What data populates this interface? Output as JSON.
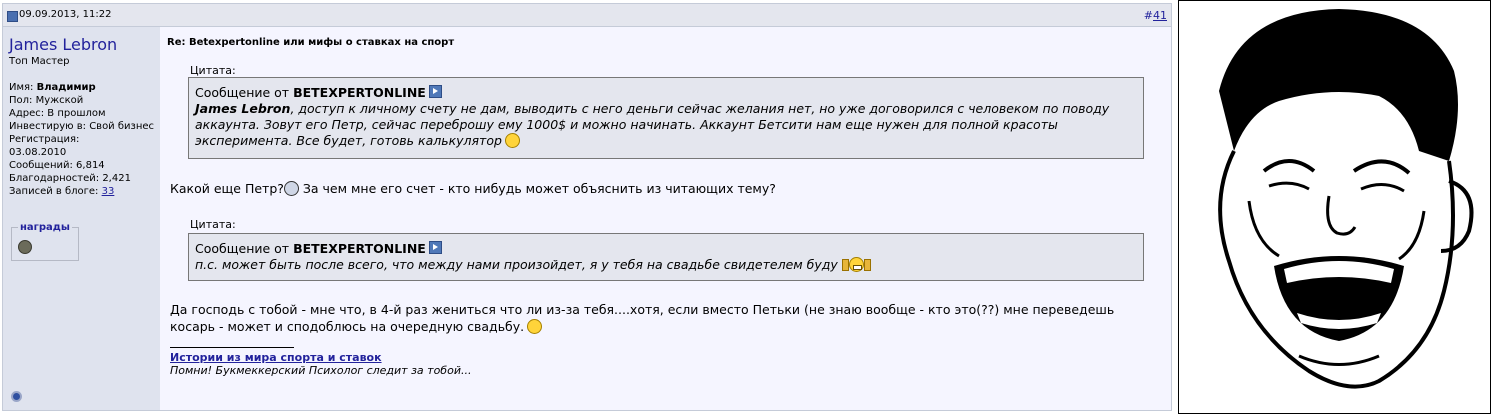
{
  "post": {
    "date": "09.09.2013, 11:22",
    "number_prefix": "#",
    "number": "41",
    "title": "Re: Betexpertonline или мифы о ставках на спорт"
  },
  "user": {
    "name": "James Lebron",
    "rank": "Топ Мастер",
    "name_label": "Имя: ",
    "name_value": "Владимир",
    "gender": "Пол: Мужской",
    "address": "Адрес: В прошлом",
    "invest": "Инвестирую в: Свой бизнес",
    "reg_label": "Регистрация:",
    "reg_date": "03.08.2010",
    "messages": "Сообщений: 6,814",
    "thanks": "Благодарностей: 2,421",
    "blog_label": "Записей в блоге: ",
    "blog_count": "33",
    "awards_label": "награды"
  },
  "quotes": [
    {
      "label": "Цитата:",
      "from_prefix": "Сообщение от ",
      "author": "BETEXPERTONLINE",
      "text_bold": "James Lebron",
      "text": ", доступ к личному счету не дам, выводить с него деньги сейчас желания нет, но уже договорился с человеком по поводу аккаунта. Зовут его Петр, сейчас переброшу ему 1000$ и можно начинать. Аккаунт Бетсити нам еще нужен для полной красоты эксперимента. Все будет, готовь калькулятор"
    },
    {
      "label": "Цитата:",
      "from_prefix": "Сообщение от ",
      "author": "BETEXPERTONLINE",
      "text": "п.с. может быть после всего, что между нами произойдет, я у тебя на свадьбе свидетелем буду"
    }
  ],
  "messages": [
    {
      "a": "Какой еще Петр?",
      "b": " За чем мне его счет - кто нибудь может объяснить из читающих тему?"
    },
    {
      "text": "Да господь с тобой - мне что, в 4-й раз жениться что ли из-за тебя....хотя, если вместо Петьки (не знаю вообще - кто это(??) мне переведешь косарь - может и сподоблюсь на очередную свадьбу."
    }
  ],
  "signature": {
    "link": "Истории из мира спорта и ставок",
    "text": "Помни! Букмеккерский Психолог следит за тобой..."
  },
  "colors": {
    "link": "#22229c",
    "sidebar": "#dfe3ee",
    "quote_bg": "#e4e6ee"
  }
}
